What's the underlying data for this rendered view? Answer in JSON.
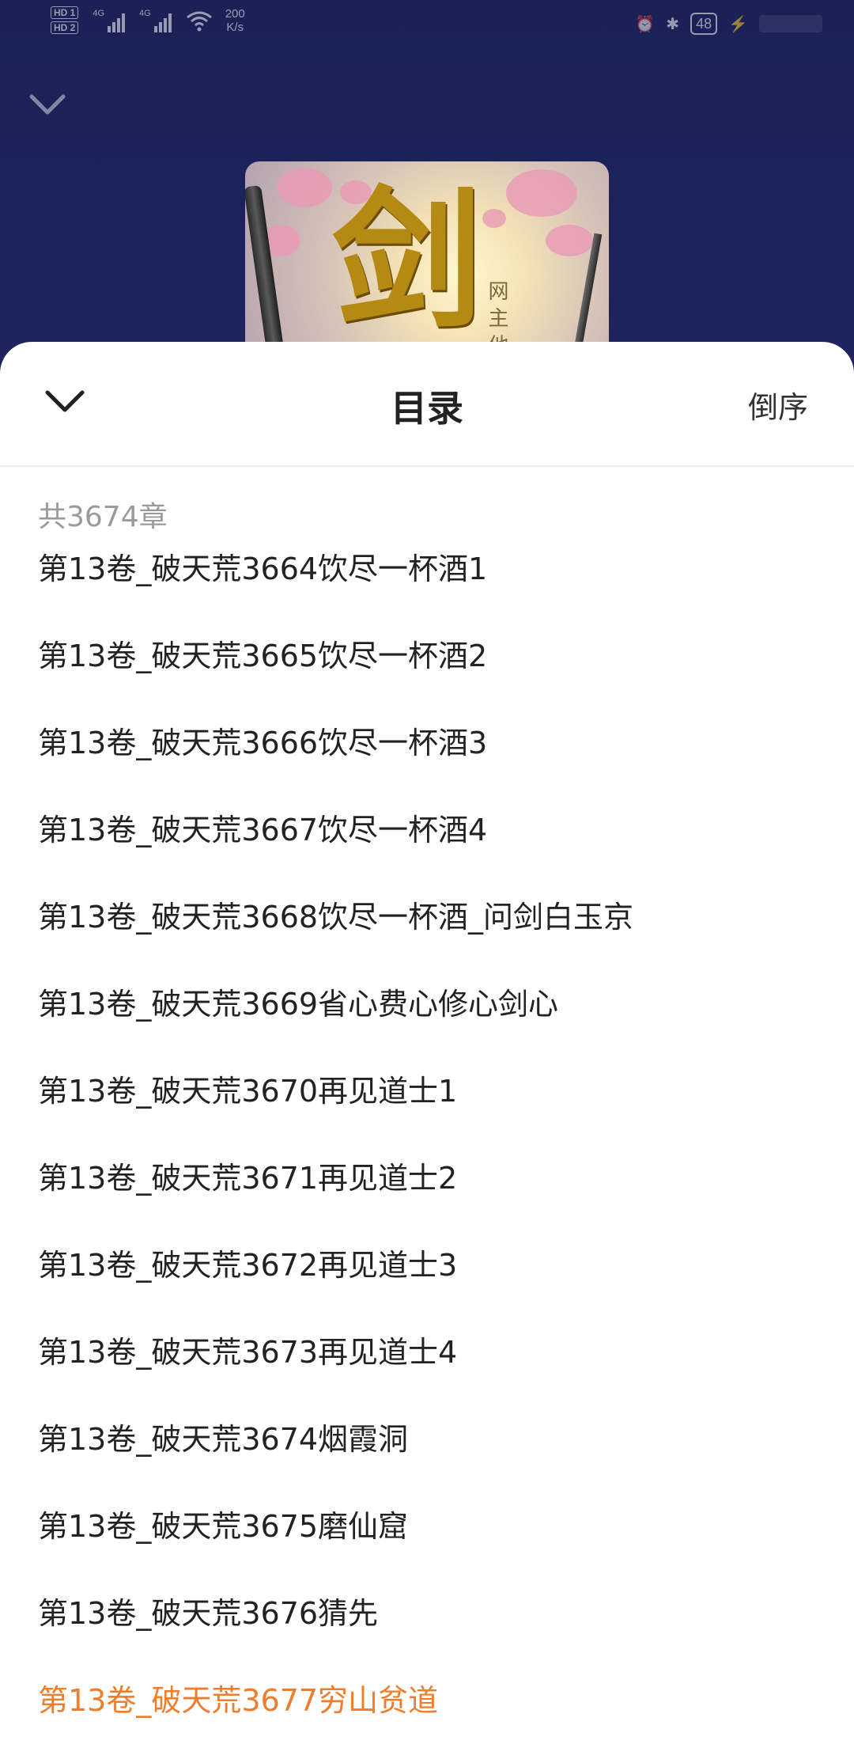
{
  "status_bar": {
    "sim1": "HD 1",
    "sim2": "HD 2",
    "net1": "4G",
    "net2": "4G",
    "speed_value": "200",
    "speed_unit": "K/s",
    "battery": "48"
  },
  "cover": {
    "calligraphy": "剑",
    "side_text": "网 主 他"
  },
  "toc": {
    "title": "目录",
    "sort_label": "倒序",
    "total": "共3674章",
    "current_index": 13,
    "current_color": "#ef7d2b",
    "chapters": [
      "第13卷_破天荒3664饮尽一杯酒1",
      "第13卷_破天荒3665饮尽一杯酒2",
      "第13卷_破天荒3666饮尽一杯酒3",
      "第13卷_破天荒3667饮尽一杯酒4",
      "第13卷_破天荒3668饮尽一杯酒_问剑白玉京",
      "第13卷_破天荒3669省心费心修心剑心",
      "第13卷_破天荒3670再见道士1",
      "第13卷_破天荒3671再见道士2",
      "第13卷_破天荒3672再见道士3",
      "第13卷_破天荒3673再见道士4",
      "第13卷_破天荒3674烟霞洞",
      "第13卷_破天荒3675磨仙窟",
      "第13卷_破天荒3676猜先",
      "第13卷_破天荒3677穷山贫道"
    ]
  },
  "icons": {
    "collapse_top": "chevron-down-icon",
    "collapse_sheet": "chevron-down-icon",
    "wifi": "wifi-icon",
    "alarm": "alarm-icon",
    "bluetooth": "bluetooth-icon",
    "charging": "charging-icon"
  }
}
